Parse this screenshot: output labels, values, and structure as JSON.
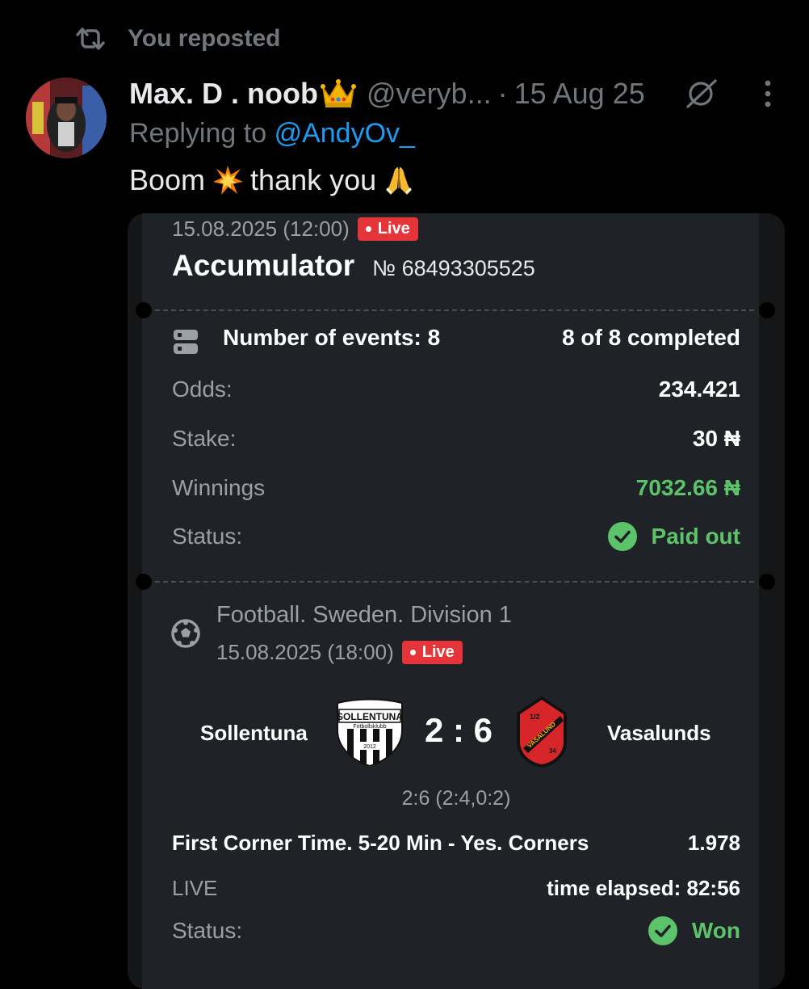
{
  "repost": {
    "text": "You reposted",
    "icon": "repost-icon"
  },
  "tweet": {
    "author_name": "Max. D . noob",
    "author_handle": "@veryb...",
    "separator": "·",
    "date": "15 Aug 25",
    "reply_prefix": "Replying to",
    "reply_to": "@AndyOv_",
    "text_start": "Boom",
    "text_mid": "thank you",
    "emojis": [
      "crown",
      "collision",
      "folded-hands"
    ]
  },
  "bet": {
    "date": "15.08.2025 (12:00)",
    "live_label": "Live",
    "type": "Accumulator",
    "number": "№ 68493305525",
    "events_label": "Number of events: 8",
    "completed": "8 of 8 completed",
    "odds_label": "Odds:",
    "odds_value": "234.421",
    "stake_label": "Stake:",
    "stake_value": "30 ₦",
    "winnings_label": "Winnings",
    "winnings_value": "7032.66 ₦",
    "status_label": "Status:",
    "status_value": "Paid out"
  },
  "match": {
    "league": "Football. Sweden. Division 1",
    "date": "15.08.2025 (18:00)",
    "live_label": "Live",
    "home_team": "Sollentuna",
    "away_team": "Vasalunds",
    "home_score": "2",
    "away_score": "6",
    "score_text": "2 : 6",
    "score_detail": "2:6 (2:4,0:2)",
    "bet_name": "First Corner Time. 5-20 Min - Yes. Corners",
    "bet_odds": "1.978",
    "live_text": "LIVE",
    "elapsed": "time elapsed: 82:56",
    "status_label": "Status:",
    "status_value": "Won",
    "home_logo_text": [
      "SOLLENTUNA",
      "Fotbollsklubb",
      "2012"
    ],
    "away_logo_text": [
      "1/2",
      "VASALUND",
      "34"
    ]
  },
  "colors": {
    "background": "#000000",
    "card": "#1f2227",
    "muted": "#71767b",
    "link": "#1d9bf0",
    "green": "#5cc36a",
    "live_red": "#e5343a"
  }
}
